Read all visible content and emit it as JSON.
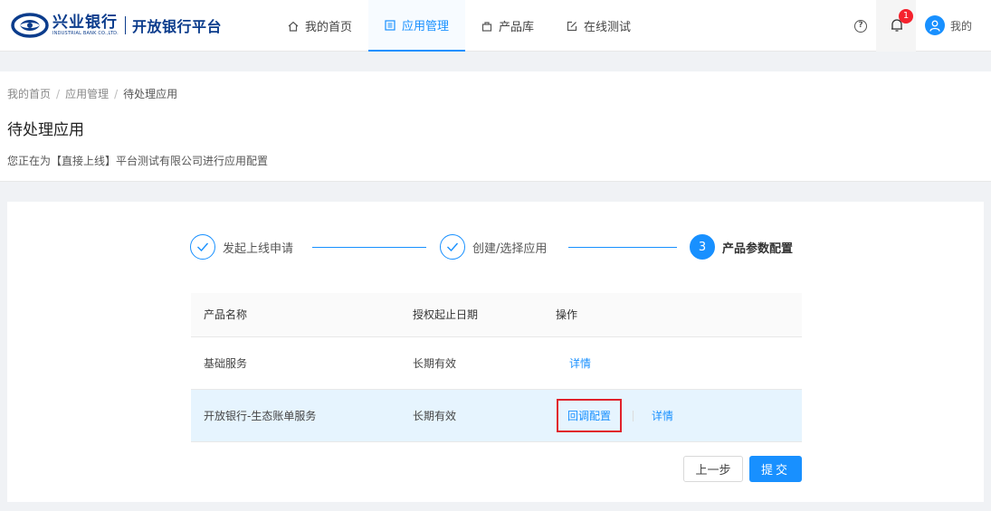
{
  "header": {
    "logo_cn": "兴业银行",
    "logo_en": "INDUSTRIAL BANK CO.,LTD.",
    "platform": "开放银行平台",
    "nav": [
      {
        "label": "我的首页",
        "icon": "home-icon"
      },
      {
        "label": "应用管理",
        "icon": "app-list-icon"
      },
      {
        "label": "产品库",
        "icon": "bag-icon"
      },
      {
        "label": "在线测试",
        "icon": "edit-icon"
      }
    ],
    "active_nav": "应用管理",
    "help": "?",
    "notifications": "1",
    "user": "我的"
  },
  "breadcrumb": [
    "我的首页",
    "应用管理",
    "待处理应用"
  ],
  "page": {
    "title": "待处理应用",
    "desc": "您正在为【直接上线】平台测试有限公司进行应用配置"
  },
  "steps": [
    {
      "label": "发起上线申请",
      "status": "done"
    },
    {
      "label": "创建/选择应用",
      "status": "done"
    },
    {
      "label": "产品参数配置",
      "status": "current",
      "num": "3"
    }
  ],
  "table": {
    "headers": [
      "产品名称",
      "授权起止日期",
      "操作"
    ],
    "rows": [
      {
        "name": "基础服务",
        "date": "长期有效",
        "ops": [
          "详情"
        ]
      },
      {
        "name": "开放银行-生态账单服务",
        "date": "长期有效",
        "ops": [
          "回调配置",
          "详情"
        ]
      }
    ]
  },
  "buttons": {
    "prev": "上一步",
    "submit": "提交"
  },
  "colors": {
    "primary": "#1890ff",
    "brand": "#0b3c8c",
    "highlight_row": "#e6f4fe",
    "annotation": "#e0222b",
    "badge": "#f5222d"
  }
}
